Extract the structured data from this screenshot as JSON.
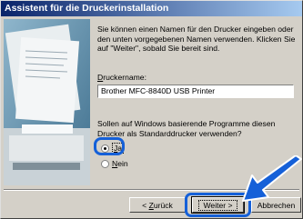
{
  "window": {
    "title": "Assistent für die Druckerinstallation"
  },
  "content": {
    "description": "Sie können einen Namen für den Drucker eingeben oder den unten vorgegebenen Namen verwenden. Klicken Sie auf \"Weiter\", sobald Sie bereit sind.",
    "printer_name_label_first": "D",
    "printer_name_label_rest": "ruckername:",
    "printer_name_value": "Brother MFC-8840D USB Printer",
    "question": "Sollen auf Windows basierende Programme diesen Drucker als Standarddrucker verwenden?",
    "options": [
      {
        "first": "J",
        "rest": "a",
        "selected": true
      },
      {
        "first": "N",
        "rest": "ein",
        "selected": false
      }
    ]
  },
  "buttons": {
    "back_prefix": "< ",
    "back_first": "Z",
    "back_rest": "urück",
    "next": "Weiter >",
    "cancel": "Abbrechen"
  },
  "colors": {
    "title_bar": "#0a246a",
    "highlight": "#1560d8",
    "dialog_bg": "#d4d0c8"
  },
  "icons": {
    "arrow": "callout-arrow-icon"
  }
}
